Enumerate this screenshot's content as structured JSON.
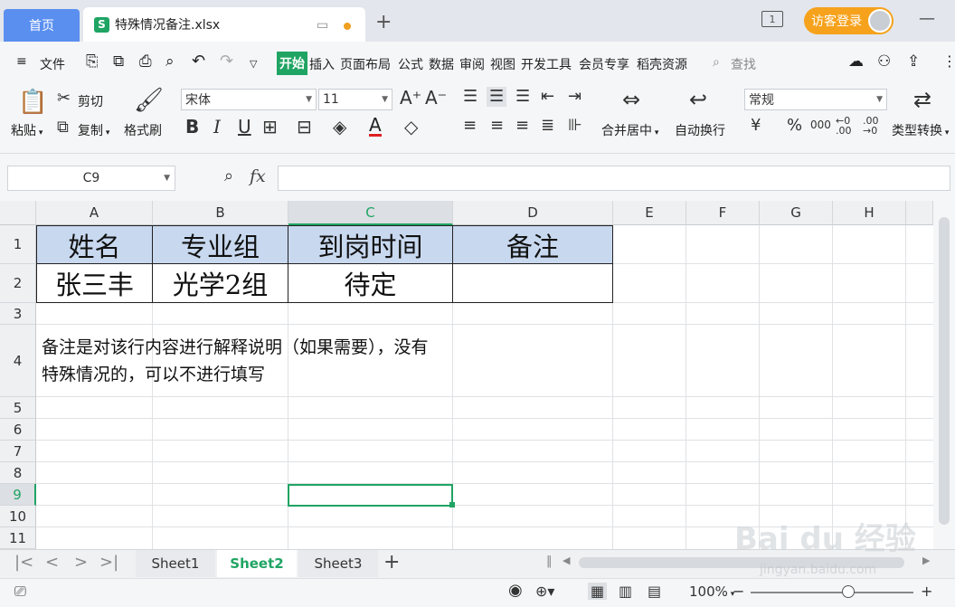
{
  "tabs": {
    "home": "首页",
    "file_icon": "S",
    "file_name": "特殊情况备注.xlsx",
    "new_tab": "+",
    "window_count": "1",
    "login": "访客登录"
  },
  "menu": {
    "file": "文件",
    "items": [
      "开始",
      "插入",
      "页面布局",
      "公式",
      "数据",
      "审阅",
      "视图",
      "开发工具",
      "会员专享",
      "稻壳资源"
    ],
    "search": "查找"
  },
  "ribbon": {
    "paste": "粘贴",
    "cut": "剪切",
    "copy": "复制",
    "format_painter": "格式刷",
    "font_name": "宋体",
    "font_size": "11",
    "bold": "B",
    "italic": "I",
    "underline": "U",
    "merge_center": "合并居中",
    "wrap_text": "自动换行",
    "number_format": "常规",
    "currency": "¥",
    "percent": "%",
    "thousands": "000",
    "inc_decimal": "←0 .00",
    "dec_decimal": ".00 →0",
    "type_convert": "类型转换"
  },
  "formula_bar": {
    "name_box": "C9",
    "fx": "fx",
    "value": ""
  },
  "sheet": {
    "columns": [
      "A",
      "B",
      "C",
      "D",
      "E",
      "F",
      "G",
      "H"
    ],
    "rows": [
      "1",
      "2",
      "3",
      "4",
      "5",
      "6",
      "7",
      "8",
      "9",
      "10",
      "11"
    ],
    "header_row": [
      "姓名",
      "专业组",
      "到岗时间",
      "备注"
    ],
    "data_row": [
      "张三丰",
      "光学2组",
      "待定",
      ""
    ],
    "note": "备注是对该行内容进行解释说明（如果需要），没有特殊情况的，可以不进行填写",
    "selected_cell": "C9",
    "header_fill": "#c8d8ef",
    "accent": "#1fa463"
  },
  "sheet_tabs": [
    "Sheet1",
    "Sheet2",
    "Sheet3"
  ],
  "active_sheet": "Sheet2",
  "add_sheet": "+",
  "status": {
    "zoom": "100%",
    "zoom_level_pct": 60
  },
  "watermark": {
    "brand": "Bai du 经验",
    "url": "jingyan.baidu.com"
  }
}
